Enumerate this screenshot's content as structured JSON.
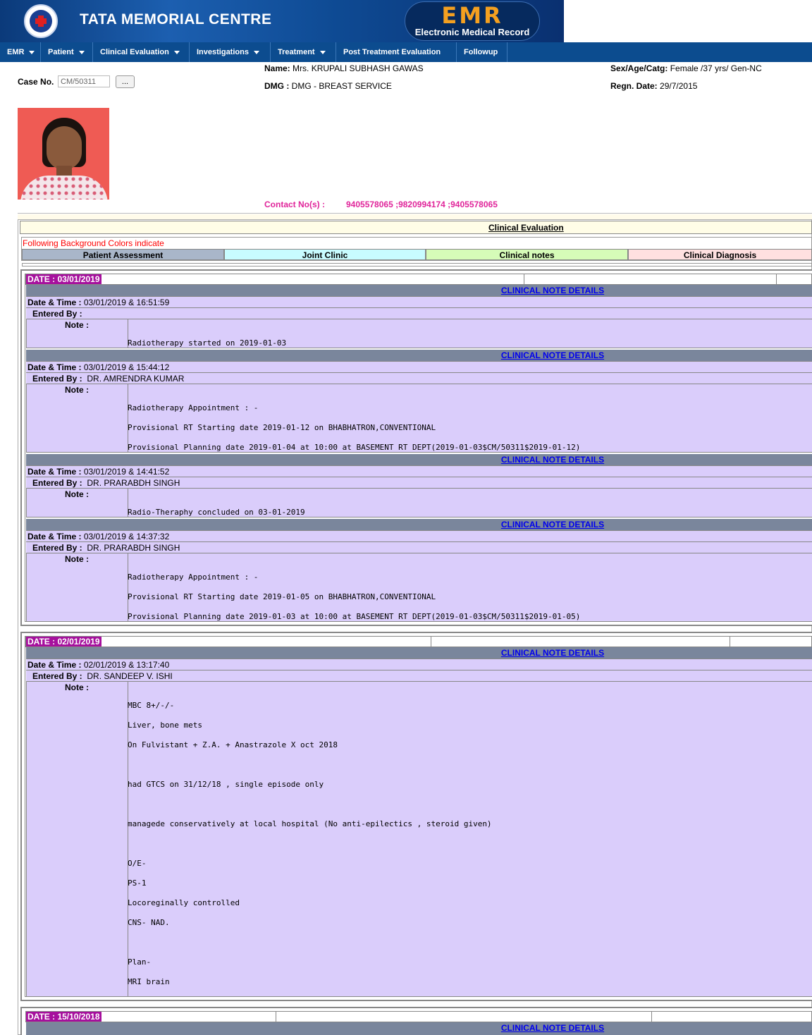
{
  "header": {
    "institution": "TATA MEMORIAL CENTRE",
    "emr_title": "EMR",
    "emr_subtitle": "Electronic Medical Record",
    "logo_icon": "tmc-logo-icon"
  },
  "nav": [
    {
      "label": "EMR",
      "dropdown": true
    },
    {
      "label": "Patient",
      "dropdown": true
    },
    {
      "label": "Clinical Evaluation",
      "dropdown": true
    },
    {
      "label": "Investigations",
      "dropdown": true
    },
    {
      "label": "Treatment",
      "dropdown": true
    },
    {
      "label": "Post Treatment Evaluation",
      "dropdown": false
    },
    {
      "label": "Followup",
      "dropdown": false
    }
  ],
  "patient": {
    "case_label": "Case No.",
    "case_value": "CM/50311",
    "lookup_button": "...",
    "name_label": "Name:",
    "name_value": "Mrs. KRUPALI SUBHASH GAWAS",
    "dmg_label": "DMG :",
    "dmg_value": "DMG - BREAST SERVICE",
    "sex_label": "Sex/Age/Catg:",
    "sex_value": "Female /37 yrs/ Gen-NC",
    "regn_label": "Regn. Date:",
    "regn_value": "29/7/2015",
    "contact_label": "Contact No(s) :",
    "contact_value": "9405578065 ;9820994174 ;9405578065"
  },
  "section": {
    "title": "Clinical Evaluation",
    "legend_caption": "Following Background Colors indicate",
    "legend": [
      {
        "label": "Patient Assessment",
        "color": "#a9b6c9"
      },
      {
        "label": "Joint Clinic",
        "color": "#c8fcff"
      },
      {
        "label": "Clinical notes",
        "color": "#d6fcb8"
      },
      {
        "label": "Clinical Diagnosis",
        "color": "#ffe0e0"
      }
    ]
  },
  "labels": {
    "details_link": "CLINICAL NOTE DETAILS",
    "datetime_label": "Date & Time :",
    "entered_label": "Entered By :",
    "note_label": "Note :"
  },
  "dates": [
    {
      "label": "DATE : 03/01/2019"
    },
    {
      "label": "DATE : 02/01/2019"
    },
    {
      "label": "DATE : 15/10/2018"
    }
  ],
  "notes": [
    {
      "datetime": "03/01/2019 & 16:51:59",
      "entered_by": "",
      "lines": [
        "Radiotherapy started on 2019-01-03"
      ]
    },
    {
      "datetime": "03/01/2019 & 15:44:12",
      "entered_by": "DR. AMRENDRA KUMAR",
      "lines": [
        "Radiotherapy Appointment : -",
        "Provisional RT Starting date 2019-01-12 on BHABHATRON,CONVENTIONAL",
        "Provisional Planning date 2019-01-04 at 10:00 at BASEMENT RT DEPT(2019-01-03$CM/50311$2019-01-12)"
      ]
    },
    {
      "datetime": "03/01/2019 & 14:41:52",
      "entered_by": "DR. PRARABDH SINGH",
      "lines": [
        "Radio-Theraphy concluded on 03-01-2019"
      ]
    },
    {
      "datetime": "03/01/2019 & 14:37:32",
      "entered_by": "DR. PRARABDH SINGH",
      "lines": [
        "Radiotherapy Appointment : -",
        "Provisional RT Starting date 2019-01-05 on BHABHATRON,CONVENTIONAL",
        "Provisional Planning date 2019-01-03 at 10:00 at BASEMENT RT DEPT(2019-01-03$CM/50311$2019-01-05)"
      ]
    },
    {
      "datetime": "02/01/2019 & 13:17:40",
      "entered_by": "DR. SANDEEP V. ISHI",
      "lines": [
        "MBC 8+/-/-",
        "Liver, bone mets",
        "On Fulvistant + Z.A. + Anastrazole X oct 2018",
        "had GTCS on 31/12/18 , single episode only",
        "managede conservatively at local hospital (No anti-epilectics , steroid given)",
        "O/E-",
        "PS-1",
        "Locoreginally controlled",
        "CNS- NAD.",
        "Plan-",
        "MRI brain"
      ]
    }
  ]
}
